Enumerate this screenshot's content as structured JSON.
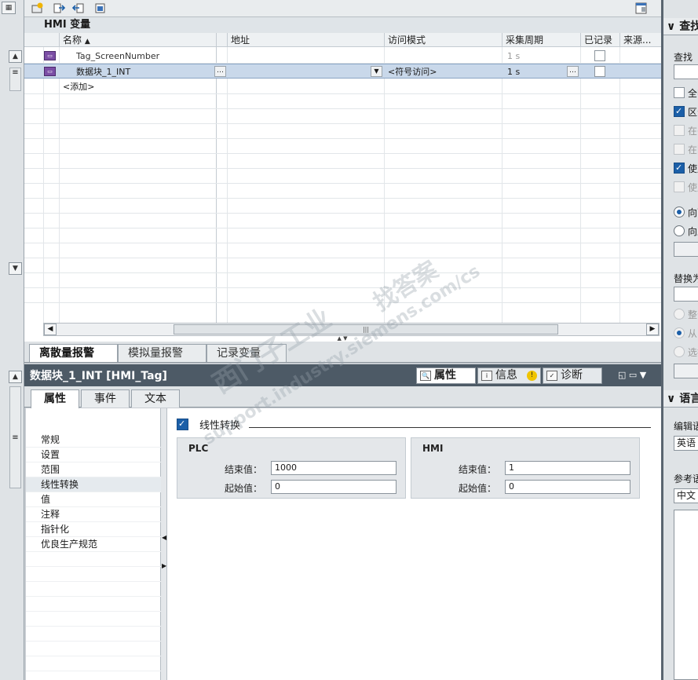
{
  "panel_title": "HMI 变量",
  "columns": [
    "名称",
    "地址",
    "访问模式",
    "采集周期",
    "已记录",
    "来源..."
  ],
  "sort_indicator": "▲",
  "rows": [
    {
      "icon": "tag-icon",
      "name": "Tag_ScreenNumber",
      "address": "",
      "access_mode": "",
      "cycle": "1 s",
      "logged": false
    },
    {
      "icon": "tag-icon",
      "name": "数据块_1_INT",
      "address": "",
      "access_mode": "<符号访问>",
      "cycle": "1 s",
      "logged": false
    }
  ],
  "add_row": "<添加>",
  "bottom_tabs": [
    "离散量报警",
    "模拟量报警",
    "记录变量"
  ],
  "properties": {
    "title": "数据块_1_INT [HMI_Tag]",
    "view_tabs": [
      "属性",
      "信息",
      "诊断"
    ],
    "sub_tabs": [
      "属性",
      "事件",
      "文本"
    ],
    "nav": [
      "常规",
      "设置",
      "范围",
      "线性转换",
      "值",
      "注释",
      "指针化",
      "优良生产规范"
    ],
    "selected_nav": "线性转换",
    "linear_scaling_label": "线性转换",
    "linear_scaling_checked": true,
    "plc": {
      "title": "PLC",
      "end_label": "结束值：",
      "end_value": "1000",
      "start_label": "起始值：",
      "start_value": "0"
    },
    "hmi": {
      "title": "HMI",
      "end_label": "结束值：",
      "end_value": "1",
      "start_label": "起始值：",
      "start_value": "0"
    }
  },
  "right_panel": {
    "find_header": "查找",
    "find_label": "查找",
    "checks": [
      {
        "label": "全字",
        "checked": false,
        "disabled": false
      },
      {
        "label": "区分",
        "checked": true,
        "disabled": false
      },
      {
        "label": "在子",
        "checked": false,
        "disabled": true
      },
      {
        "label": "在隐",
        "checked": false,
        "disabled": true
      },
      {
        "label": "使用",
        "checked": true,
        "disabled": false
      },
      {
        "label": "使用",
        "checked": false,
        "disabled": true
      }
    ],
    "radios": [
      {
        "label": "向下",
        "checked": true
      },
      {
        "label": "向上",
        "checked": false
      }
    ],
    "replace_label": "替换为",
    "replace_radios": [
      {
        "label": "整个",
        "disabled": true
      },
      {
        "label": "从当",
        "disabled": true,
        "checked": true
      },
      {
        "label": "选择",
        "disabled": true
      }
    ],
    "lang_header": "语言",
    "edit_lang_label": "编辑语",
    "edit_lang_value": "英语",
    "ref_lang_label": "参考语",
    "ref_lang_value": "中文"
  },
  "watermark": [
    "西门子工业",
    "support.industry.siemens.com/cs",
    "找答案"
  ]
}
